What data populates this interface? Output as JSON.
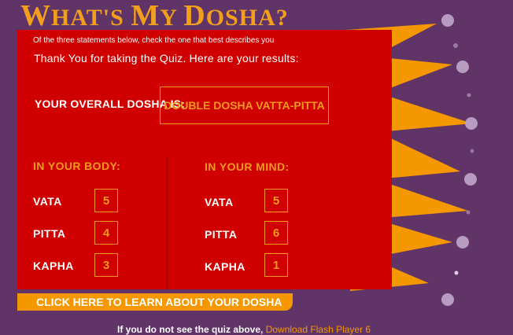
{
  "header": {
    "title_parts": [
      {
        "initial": "W",
        "rest": "HAT'S "
      },
      {
        "initial": "M",
        "rest": "Y "
      },
      {
        "initial": "D",
        "rest": "OSHA?"
      }
    ]
  },
  "quiz": {
    "instruction": "Of the three statements below, check the one that best describes you",
    "thanks": "Thank You for taking the Quiz. Here are your results:",
    "overall_label": "YOUR OVERALL DOSHA IS:",
    "overall_value": "DOUBLE DOSHA VATTA-PITTA",
    "body": {
      "heading": "IN YOUR BODY:",
      "rows": [
        {
          "label": "VATA",
          "score": "5"
        },
        {
          "label": "PITTA",
          "score": "4"
        },
        {
          "label": "KAPHA",
          "score": "3"
        }
      ]
    },
    "mind": {
      "heading": "IN YOUR MIND:",
      "rows": [
        {
          "label": "VATA",
          "score": "5"
        },
        {
          "label": "PITTA",
          "score": "6"
        },
        {
          "label": "KAPHA",
          "score": "1"
        }
      ]
    },
    "learn_button": "CLICK HERE TO LEARN ABOUT YOUR DOSHA"
  },
  "footer": {
    "text": "If you do not see the quiz above,",
    "link": "Download Flash Player 6"
  },
  "colors": {
    "background": "#613468",
    "panel": "#d00000",
    "accent": "#f39a1c"
  }
}
